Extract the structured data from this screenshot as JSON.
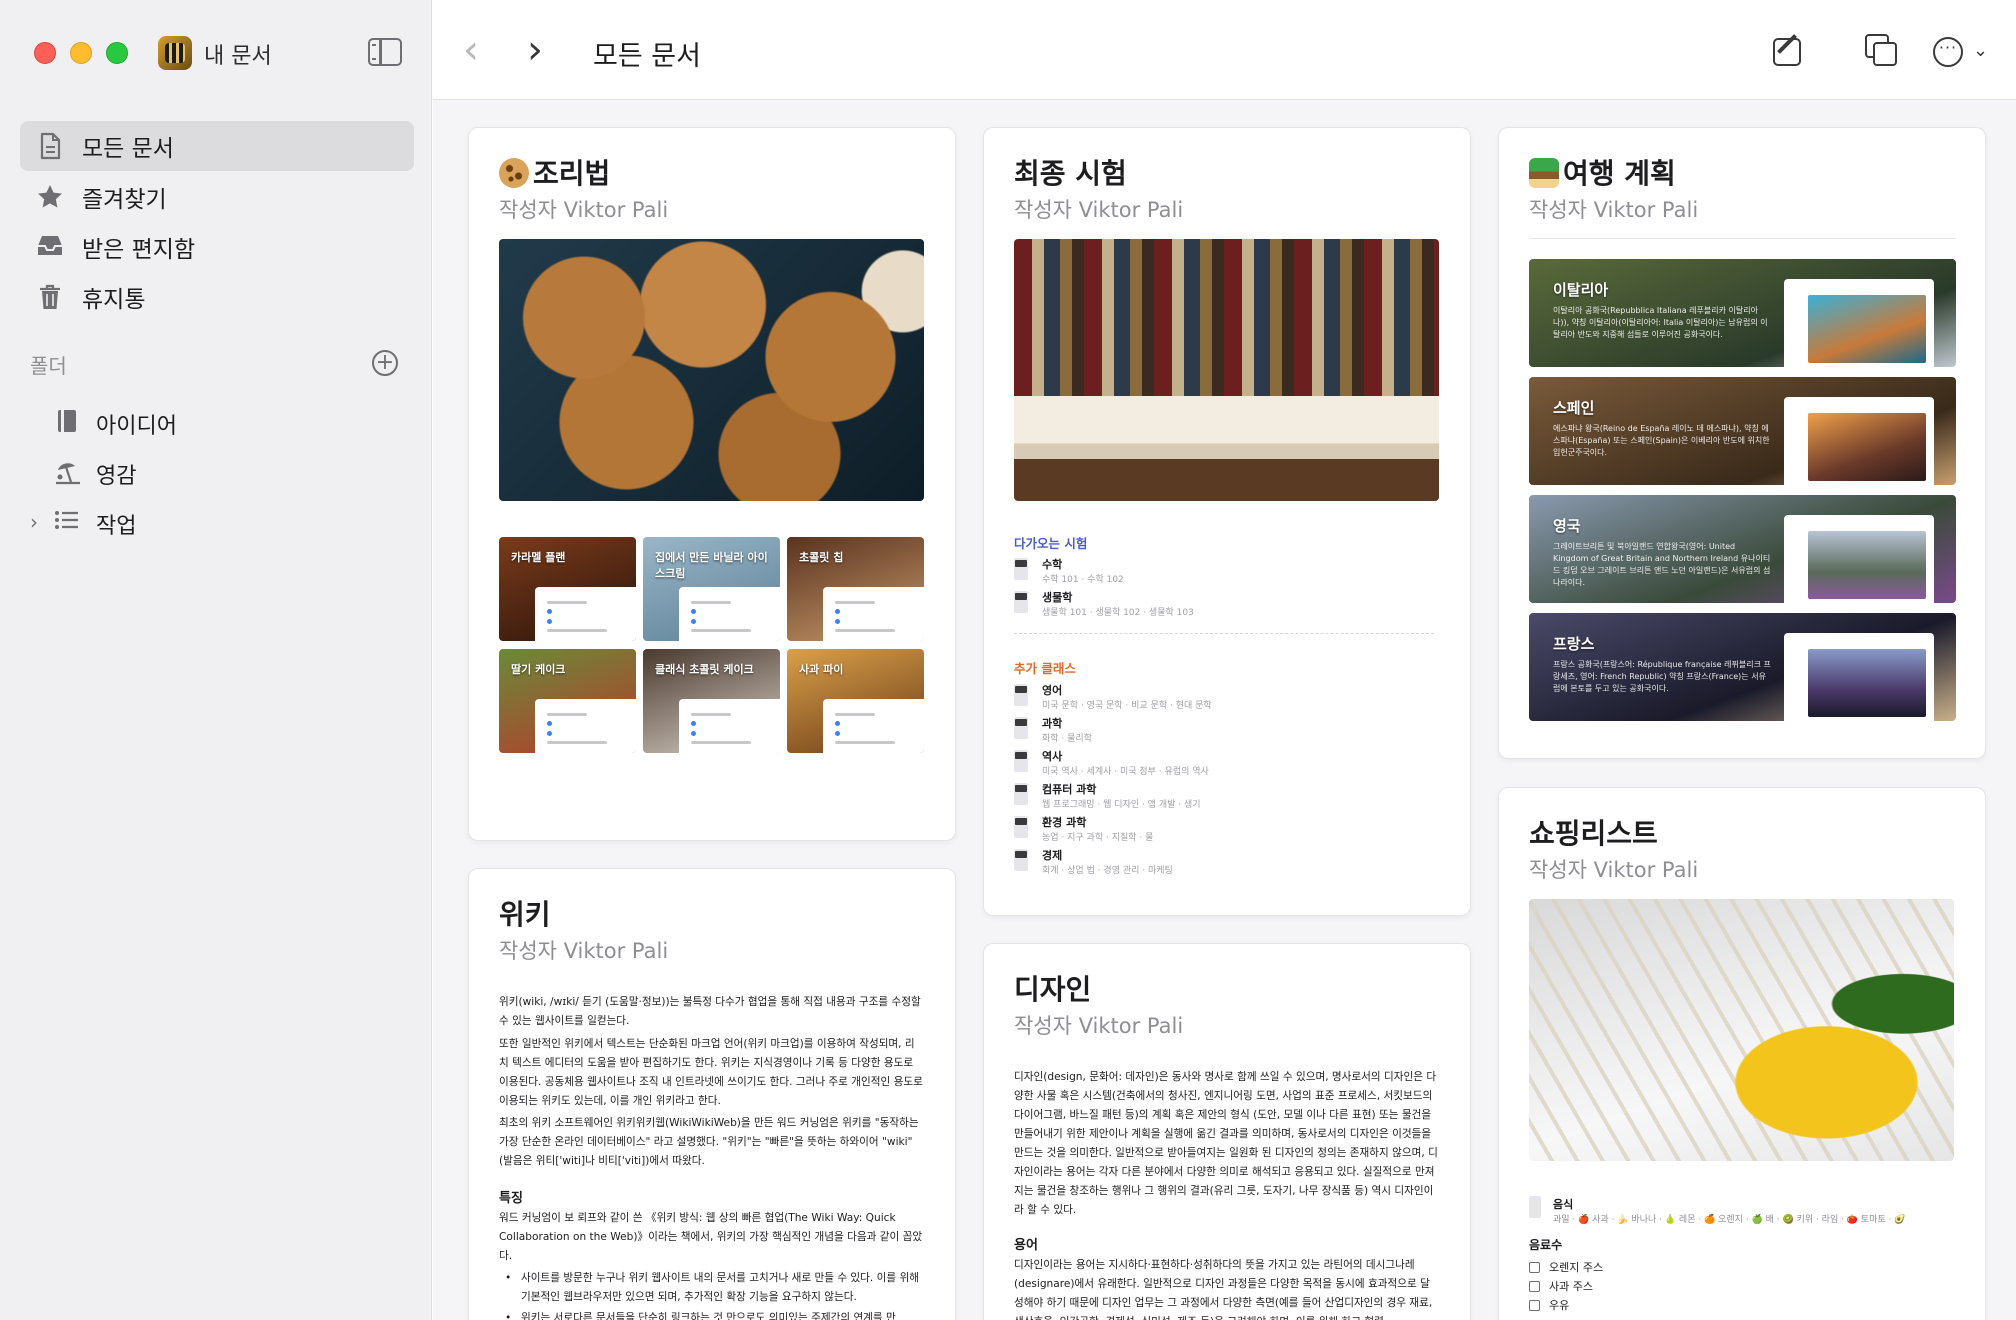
{
  "window": {
    "app_name": "내 문서",
    "colors": {
      "red": "#fe5f57",
      "yellow": "#febc2e",
      "green": "#28c840"
    }
  },
  "sidebar": {
    "items": [
      {
        "label": "모든 문서",
        "icon": "document-icon",
        "active": true
      },
      {
        "label": "즐겨찾기",
        "icon": "star-icon",
        "active": false
      },
      {
        "label": "받은 편지함",
        "icon": "inbox-tray-icon",
        "active": false
      },
      {
        "label": "휴지통",
        "icon": "trash-icon",
        "active": false
      }
    ],
    "folders_label": "폴더",
    "folders": [
      {
        "label": "아이디어",
        "icon": "notebook-icon"
      },
      {
        "label": "영감",
        "icon": "beach-umbrella-icon"
      },
      {
        "label": "작업",
        "icon": "list-icon",
        "collapsed": true
      }
    ]
  },
  "toolbar": {
    "title": "모든 문서",
    "back_icon": "chevron-left-icon",
    "forward_icon": "chevron-right-icon",
    "compose_icon": "compose-icon",
    "duplicate_icon": "duplicate-icon",
    "more_icon": "ellipsis-circle-icon"
  },
  "cards": {
    "recipes": {
      "title": "조리법",
      "author": "작성자 Viktor Pali",
      "tiles": [
        "카라멜 플랜",
        "집에서 만든 바닐라 아이스크림",
        "초콜릿 칩",
        "딸기 케이크",
        "클래식 초콜릿 케이크",
        "사과 파이"
      ]
    },
    "exam": {
      "title": "최종 시험",
      "author": "작성자 Viktor Pali",
      "upcoming_label": "다가오는 시험",
      "upcoming": [
        {
          "name": "수학",
          "detail": "수학 101 · 수학 102"
        },
        {
          "name": "생물학",
          "detail": "생물학 101 · 생물학 102 · 생물학 103"
        }
      ],
      "extra_label": "추가 클래스",
      "extra": [
        {
          "name": "영어",
          "detail": "미국 문학 · 영국 문학 · 비교 문학 · 현대 문학"
        },
        {
          "name": "과학",
          "detail": "화학 · 물리학"
        },
        {
          "name": "역사",
          "detail": "미국 역사 · 세계사 · 미국 정부 · 유럽의 역사"
        },
        {
          "name": "컴퓨터 과학",
          "detail": "웹 프로그래밍 · 웹 디자인 · 앱 개발 · 생기"
        },
        {
          "name": "환경 과학",
          "detail": "농업 · 지구 과학 · 지질학 · 물"
        },
        {
          "name": "경제",
          "detail": "회계 · 상업 법 · 경영 관리 · 마케팅"
        }
      ]
    },
    "travel": {
      "title": "여행 계획",
      "author": "작성자 Viktor Pali",
      "places": [
        {
          "name": "이탈리아",
          "desc": "이탈리아 공화국(Repubblica Italiana 레푸블리카 이탈리아나)), 약칭 이탈리아(이탈리아어: Italia 이탈리아)는 남유럽의 이탈리아 반도와 지중해 섬들로 이루어진 공화국이다."
        },
        {
          "name": "스페인",
          "desc": "에스파냐 왕국(Reino de España 레이노 데 에스파냐), 약칭 에스파냐(España) 또는 스페인(Spain)은 이베리아 반도에 위치한 입헌군주국이다."
        },
        {
          "name": "영국",
          "desc": "그레이트브리튼 및 북아일랜드 연합왕국(영어: United Kingdom of Great Britain and Northern Ireland 유나이티드 킹덤 오브 그레이트 브리튼 앤드 노던 아일랜드)은 서유럽의 섬나라이다."
        },
        {
          "name": "프랑스",
          "desc": "프랑스 공화국(프랑스어: République française 레퓌블리크 프랑세즈, 영어: French Republic) 약칭 프랑스(France)는 서유럽에 본토를 두고 있는 공화국이다."
        }
      ]
    },
    "wiki": {
      "title": "위키",
      "author": "작성자 Viktor Pali",
      "p1": "위키(wiki, /wɪki/ 듣기 (도움말·정보))는 불특정 다수가 협업을 통해 직접 내용과 구조를 수정할 수 있는 웹사이트를 일컫는다.",
      "p2": "또한 일반적인 위키에서 텍스트는 단순화된 마크업 언어(위키 마크업)를 이용하여 작성되며, 리치 텍스트 에디터의 도움을 받아 편집하기도 한다. 위키는 지식경영이나 기록 등 다양한 용도로 이용된다. 공동체용 웹사이트나 조직 내 인트라넷에 쓰이기도 한다. 그러나 주로 개인적인 용도로 이용되는 위키도 있는데, 이를 개인 위키라고 한다.",
      "p3": "최초의 위키 소프트웨어인 위키위키웹(WikiWikiWeb)을 만든 워드 커닝엄은 위키를 \"동작하는 가장 단순한 온라인 데이터베이스\" 라고 설명했다. \"위키\"는 \"빠른\"을 뜻하는 하와이어 \"wiki\"(발음은 위티['witi]나 비티['viti])에서 따왔다.",
      "h1": "특징",
      "p4": "워드 커닝엄이 보 뢰프와 같이 쓴 《위키 방식: 웹 상의 빠른 협업(The Wiki Way: Quick Collaboration on the Web)》이라는 책에서, 위키의 가장 핵심적인 개념을 다음과 같이 꼽았다.",
      "b1": "사이트를 방문한 누구나 위키 웹사이트 내의 문서를 고치거나 새로 만들 수 있다. 이를 위해 기본적인 웹브라우저만 있으면 되며, 추가적인 확장 기능을 요구하지 않는다.",
      "b2": "위키는 서로다른 문서들을 단순히 링크하는 것 만으로도 의미있는 주제간의 연계를 만"
    },
    "design": {
      "title": "디자인",
      "author": "작성자 Viktor Pali",
      "p1": "디자인(design, 문화어: 데자인)은 동사와 명사로 함께 쓰일 수 있으며, 명사로서의 디자인은 다양한 사물 혹은 시스템(건축에서의 청사진, 엔지니어링 도면, 사업의 표준 프로세스, 서킷보드의 다이어그램, 바느질 패턴 등)의 계획 혹은 제안의 형식 (도안, 모델 이나 다른 표현) 또는 물건을 만들어내기 위한 제안이나 계획을 실행에 옮긴 결과를 의미하며, 동사로서의 디자인은 이것들을 만드는 것을 의미한다. 일반적으로 받아들여지는 일원화 된 디자인의 정의는 존재하지 않으며, 디자인이라는 용어는 각자 다른 분야에서 다양한 의미로 해석되고 응용되고 있다. 실질적으로 만져지는 물건을 창조하는 행위나 그 행위의 결과(유리 그릇, 도자기, 나무 장식품 등) 역시 디자인이라 할 수 있다.",
      "h1": "용어",
      "p2": "디자인이라는 용어는 지시하다·표현하다·성취하다의 뜻을 가지고 있는 라틴어의 데시그나레(designare)에서 유래한다. 일반적으로 디자인 과정들은 다양한 목적을 동시에 효과적으로 달성해야 하기 때문에 디자인 업무는 그 과정에서 다양한 측면(예를 들어 산업디자인의 경우 재료, 생산효율, 인간공학, 경제성, 심미성, 제조 등)을 고려해야 하며, 이를 위해 하고 협력."
    },
    "shopping": {
      "title": "쇼핑리스트",
      "author": "작성자 Viktor Pali",
      "fruit_name": "음식",
      "fruit_items": "과일 · 🍎 사과 · 🍌 바나나 · 🍐 레몬 · 🍊 오렌지 · 🍏 배 · 🥝 키위 · 라임 · 🍅 토마토 · 🥑",
      "drinks_label": "음료수",
      "drinks": [
        "오렌지 주스",
        "사과 주스",
        "우유"
      ]
    }
  }
}
